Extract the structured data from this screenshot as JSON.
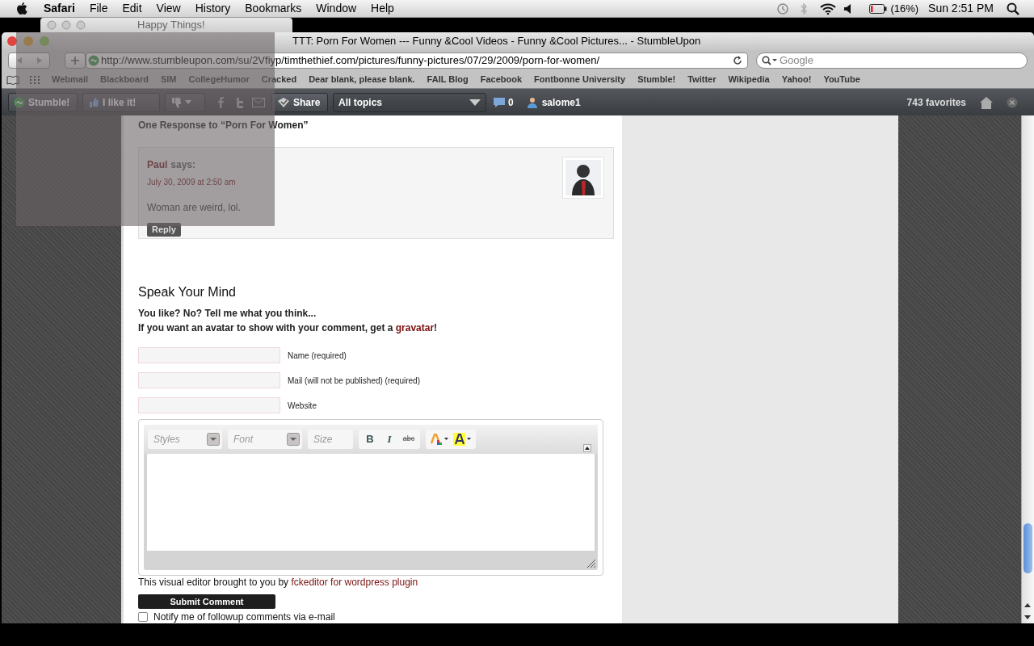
{
  "menubar": {
    "app": "Safari",
    "items": [
      "File",
      "Edit",
      "View",
      "History",
      "Bookmarks",
      "Window",
      "Help"
    ],
    "battery": "(16%)",
    "clock": "Sun 2:51 PM"
  },
  "background_window": {
    "title": "Happy Things!"
  },
  "window": {
    "title": "TTT: Porn For Women --- Funny &Cool Videos - Funny &Cool Pictures... - StumbleUpon",
    "url": "http://www.stumbleupon.com/su/2Vfiyp/timthethief.com/pictures/funny-pictures/07/29/2009/porn-for-women/",
    "search": {
      "placeholder": "Google"
    }
  },
  "bookmarks": [
    "Webmail",
    "Blackboard",
    "SIM",
    "CollegeHumor",
    "Cracked",
    "Dear blank, please blank.",
    "FAIL Blog",
    "Facebook",
    "Fontbonne University",
    "Stumble!",
    "Twitter",
    "Wikipedia",
    "Yahoo!",
    "YouTube"
  ],
  "stumble_toolbar": {
    "stumble": "Stumble!",
    "like": "I like it!",
    "share": "Share",
    "topics": "All topics",
    "comments": "0",
    "user": "salome1",
    "favorites": "743 favorites"
  },
  "comments": {
    "heading": "One Response to “Porn For Women”",
    "items": [
      {
        "author": "Paul",
        "says": "says:",
        "date": "July 30, 2009 at 2:50 am",
        "text": "Woman are weird, lol.",
        "reply": "Reply"
      }
    ]
  },
  "form": {
    "heading": "Speak Your Mind",
    "intro": "You like? No? Tell me what you think...",
    "avatar_note": {
      "before": "If you want an avatar to show with your comment, get a ",
      "link": "gravatar",
      "after": "!"
    },
    "fields": [
      {
        "label": "Name (required)"
      },
      {
        "label": "Mail (will not be published) (required)"
      },
      {
        "label": "Website"
      }
    ],
    "editor": {
      "combos": [
        {
          "placeholder": "Styles"
        },
        {
          "placeholder": "Font"
        },
        {
          "placeholder": "Size"
        }
      ],
      "format_buttons": [
        {
          "kind": "bold",
          "label": "B"
        },
        {
          "kind": "italic",
          "label": "I"
        },
        {
          "kind": "strike",
          "label": "abc"
        }
      ]
    },
    "credit": {
      "before": "This visual editor brought to you by ",
      "link": "fckeditor for wordpress plugin"
    },
    "submit": "Submit Comment",
    "notify": {
      "label": "Notify me of followup comments via e-mail",
      "checked": false
    }
  }
}
